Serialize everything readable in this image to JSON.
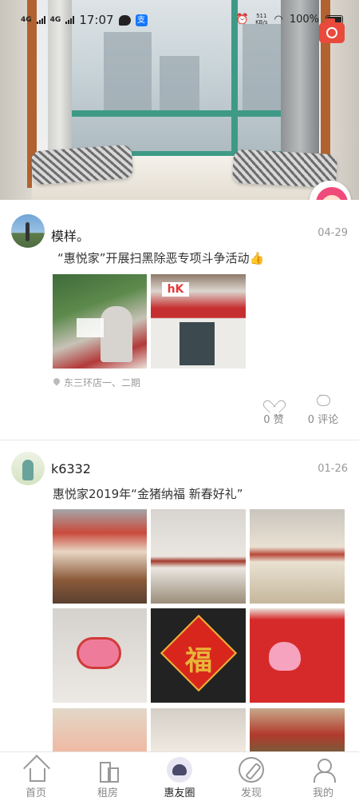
{
  "status_bar": {
    "signal_1": "4G",
    "signal_2": "4G",
    "time": "17:07",
    "net_speed_value": "511",
    "net_speed_unit": "KB/s",
    "battery": "100%"
  },
  "posts": [
    {
      "username": "模样。",
      "date": "04-29",
      "content": "“惠悦家”开展扫黑除恶专项斗争活动👍",
      "photos": [
        "photo-volunteers-flyers",
        "photo-storefront-banner"
      ],
      "location": "东三环店一、二期",
      "likes_label": "0 赞",
      "comments_label": "0 评论"
    },
    {
      "username": "k6332",
      "date": "01-26",
      "content": "惠悦家2019年“金猪纳福 新春好礼”",
      "photos": [
        "photo-lanterns-ceiling",
        "photo-shelves-wall",
        "photo-dining-room",
        "photo-pig-lantern",
        "photo-fu-poster",
        "photo-peppa-gift-box",
        "photo-pig-dolls",
        "photo-shop-interior",
        "photo-red-shelves"
      ]
    }
  ],
  "tabbar": {
    "items": [
      {
        "label": "首页",
        "icon": "home-icon"
      },
      {
        "label": "租房",
        "icon": "building-icon"
      },
      {
        "label": "惠友圈",
        "icon": "friends-icon",
        "active": true
      },
      {
        "label": "发现",
        "icon": "compass-icon"
      },
      {
        "label": "我的",
        "icon": "person-icon"
      }
    ]
  },
  "colors": {
    "accent_red": "#e84a3c",
    "window_frame": "#3e9a86",
    "text_primary": "#222222",
    "text_secondary": "#999999"
  }
}
